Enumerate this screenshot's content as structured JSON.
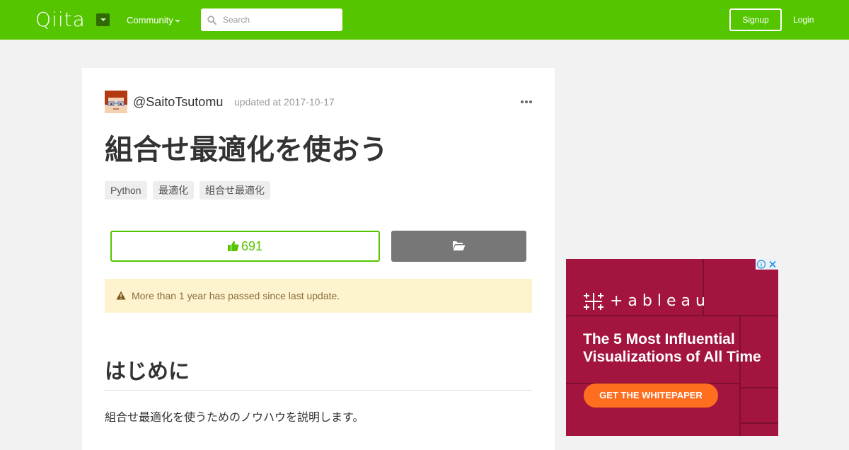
{
  "header": {
    "logo": "Qiita",
    "community_label": "Community",
    "search_placeholder": "Search",
    "signup_label": "Signup",
    "login_label": "Login"
  },
  "article": {
    "username": "@SaitoTsutomu",
    "updated": "updated at 2017-10-17",
    "title": "組合せ最適化を使おう",
    "tags": [
      "Python",
      "最適化",
      "組合せ最適化"
    ],
    "likes": "691",
    "alert": "More than 1 year has passed since last update.",
    "section_heading": "はじめに",
    "paragraph": "組合せ最適化を使うためのノウハウを説明します。"
  },
  "ad": {
    "brand": "+ableau",
    "headline": "The 5 Most Influential Visualizations of All Time",
    "cta": "GET THE WHITEPAPER"
  },
  "colors": {
    "brand_green": "#55c500",
    "ad_background": "#a3153e",
    "ad_cta": "#ff6d1f",
    "alert_background": "#fdf3cf"
  }
}
